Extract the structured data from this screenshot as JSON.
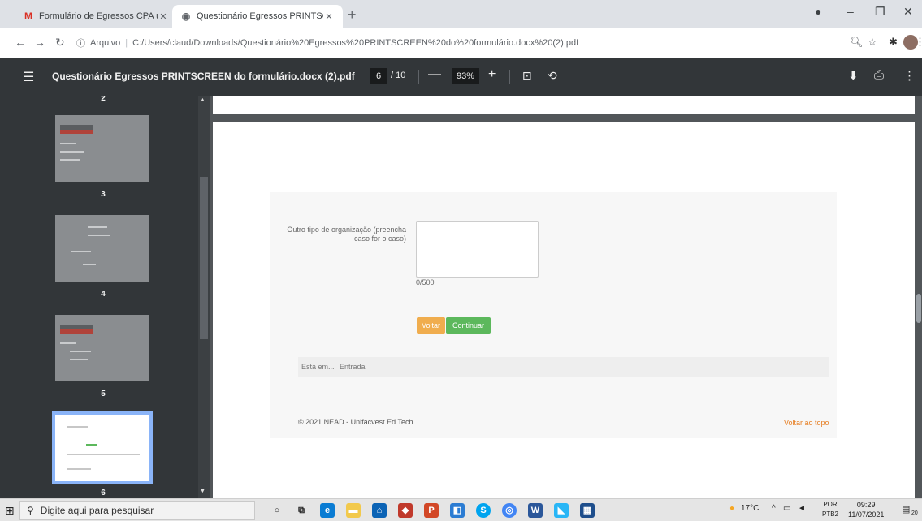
{
  "browser": {
    "tabs": [
      {
        "title": "Formulário de Egressos CPA unifi",
        "favicon": "gmail-icon",
        "active": false
      },
      {
        "title": "Questionário Egressos PRINTSCE",
        "favicon": "globe-icon",
        "active": true
      }
    ],
    "new_tab": "+",
    "window_controls": {
      "minimize": "–",
      "maximize": "❐",
      "close": "✕"
    },
    "address": {
      "scheme_label": "Arquivo",
      "separator": "|",
      "url": "C:/Users/claud/Downloads/Questionário%20Egressos%20PRINTSCREEN%20do%20formulário.docx%20(2).pdf"
    }
  },
  "pdf_toolbar": {
    "title": "Questionário Egressos PRINTSCREEN do formulário.docx (2).pdf",
    "current_page": "6",
    "page_count": "/ 10",
    "zoom": "93%",
    "minus": "—",
    "plus": "+"
  },
  "thumbnails": {
    "top_partial_label": "2",
    "pages": [
      {
        "label": "3",
        "selected": false
      },
      {
        "label": "4",
        "selected": false
      },
      {
        "label": "5",
        "selected": false
      },
      {
        "label": "6",
        "selected": true
      }
    ]
  },
  "form": {
    "field_label": "Outro tipo de organização (preencha caso for o caso)",
    "counter": "0/500",
    "back_button": "Voltar",
    "continue_button": "Continuar",
    "breadcrumb_prefix": "Está em...",
    "breadcrumb_item": "Entrada"
  },
  "footer": {
    "copyright": "© 2021 NEAD - Unifacvest Ed Tech",
    "back_to_top": "Voltar ao topo"
  },
  "taskbar": {
    "search_placeholder": "Digite aqui para pesquisar",
    "weather": "17°C",
    "language_top": "POR",
    "language_bottom": "PTB2",
    "time": "09:29",
    "date": "11/07/2021",
    "notification_count": "20"
  },
  "colors": {
    "voltar": "#f0ad4e",
    "continuar": "#5cb85c",
    "back_to_top": "#e67e22",
    "thumb_selected_border": "#8ab4f8"
  }
}
